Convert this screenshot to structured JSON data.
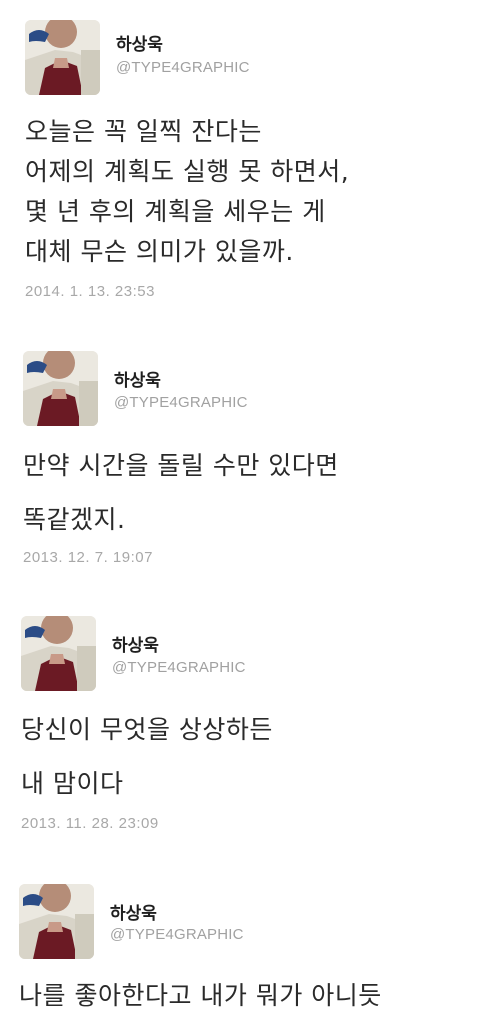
{
  "tweets": [
    {
      "name": "하상욱",
      "handle": "@TYPE4GRAPHIC",
      "lines": [
        "오늘은 꼭 일찍 잔다는",
        "어제의 계획도 실행 못 하면서,",
        "몇 년 후의 계획을 세우는 게",
        "대체 무슨 의미가 있을까."
      ],
      "timestamp": "2014. 1. 13. 23:53"
    },
    {
      "name": "하상욱",
      "handle": "@TYPE4GRAPHIC",
      "lines": [
        "만약 시간을 돌릴 수만 있다면",
        "똑같겠지."
      ],
      "timestamp": "2013. 12. 7. 19:07"
    },
    {
      "name": "하상욱",
      "handle": "@TYPE4GRAPHIC",
      "lines": [
        "당신이 무엇을 상상하든",
        "내 맘이다"
      ],
      "timestamp": "2013. 11. 28. 23:09"
    },
    {
      "name": "하상욱",
      "handle": "@TYPE4GRAPHIC",
      "lines": [
        "나를 좋아한다고 내가 뭐가 아니듯"
      ],
      "timestamp": ""
    }
  ],
  "avatar_icon": "profile-photo-avatar"
}
